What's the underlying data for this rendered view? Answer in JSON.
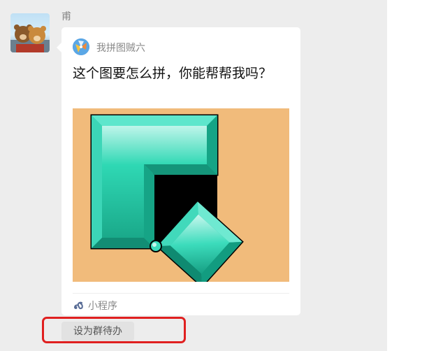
{
  "message": {
    "sender_name": "甫",
    "card": {
      "app_name": "我拼图贼六",
      "title": "这个图要怎么拼，你能帮帮我吗？",
      "source_label": "小程序"
    },
    "action_button_label": "设为群待办"
  },
  "icons": {
    "avatar": "avatar-bears",
    "app": "puzzle-app-icon",
    "mini_program": "mini-program-icon"
  },
  "colors": {
    "chat_background": "#ededed",
    "card_background": "#ffffff",
    "preview_background": "#f1bb7b",
    "piece_teal": "#2fd8b4",
    "highlight": "#e02020"
  }
}
